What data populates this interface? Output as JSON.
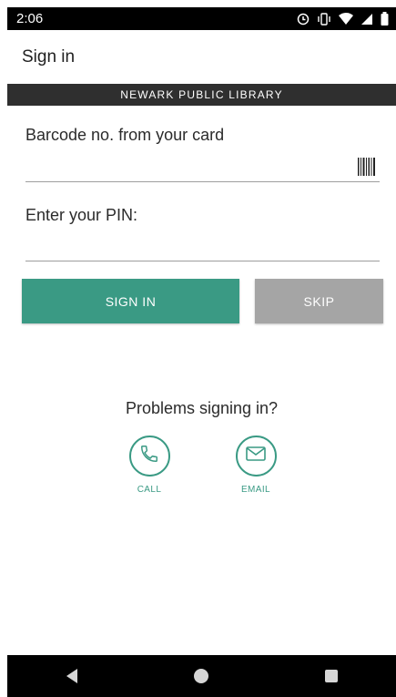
{
  "status_bar": {
    "time": "2:06",
    "icons": [
      "sync-icon",
      "vibrate-icon",
      "wifi-icon",
      "signal-icon",
      "battery-icon"
    ]
  },
  "app_bar": {
    "title": "Sign in"
  },
  "banner": {
    "text": "NEWARK PUBLIC LIBRARY"
  },
  "form": {
    "barcode_label": "Barcode no. from your card",
    "barcode_value": "",
    "pin_label": "Enter your PIN:",
    "pin_value": ""
  },
  "buttons": {
    "sign_in": "SIGN IN",
    "skip": "SKIP"
  },
  "help": {
    "title": "Problems signing in?",
    "call_label": "CALL",
    "email_label": "EMAIL"
  },
  "colors": {
    "accent": "#3a9a84",
    "skip_button": "#a5a5a5",
    "banner": "#2f2f2f"
  },
  "nav_bar": {
    "icons": [
      "back-icon",
      "home-icon",
      "recents-icon"
    ]
  }
}
